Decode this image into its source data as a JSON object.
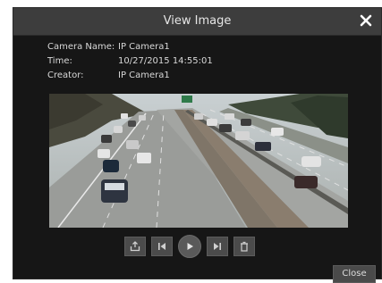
{
  "dialog": {
    "title": "View Image",
    "close_icon": "close-icon"
  },
  "info": {
    "camera_name_label": "Camera Name:",
    "camera_name_value": "IP Camera1",
    "time_label": "Time:",
    "time_value": "10/27/2015 14:55:01",
    "creator_label": "Creator:",
    "creator_value": "IP Camera1"
  },
  "viewer": {
    "content": "highway-traffic-snapshot"
  },
  "controls": {
    "icons": [
      "export-icon",
      "previous-icon",
      "play-icon",
      "next-icon",
      "delete-icon"
    ]
  },
  "footer": {
    "close_label": "Close"
  },
  "colors": {
    "dialog_bg": "#161616",
    "titlebar_bg": "#3d3d3d",
    "text": "#d8d8d8",
    "button_bg": "#4b4b4b"
  }
}
